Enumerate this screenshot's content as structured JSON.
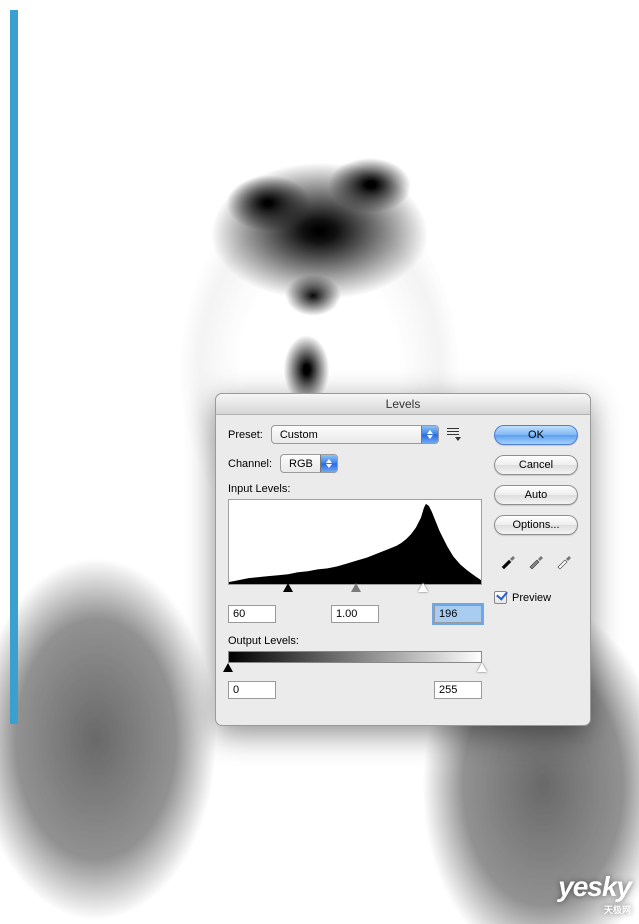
{
  "dialog": {
    "title": "Levels",
    "preset_label": "Preset:",
    "preset_value": "Custom",
    "channel_label": "Channel:",
    "channel_value": "RGB",
    "input_label": "Input Levels:",
    "output_label": "Output Levels:",
    "input_black": "60",
    "input_mid": "1.00",
    "input_white": "196",
    "output_black": "0",
    "output_white": "255"
  },
  "buttons": {
    "ok": "OK",
    "cancel": "Cancel",
    "auto": "Auto",
    "options": "Options..."
  },
  "preview": {
    "label": "Preview",
    "checked": true
  },
  "watermark": {
    "text": "yesky",
    "sub": "天极网"
  }
}
